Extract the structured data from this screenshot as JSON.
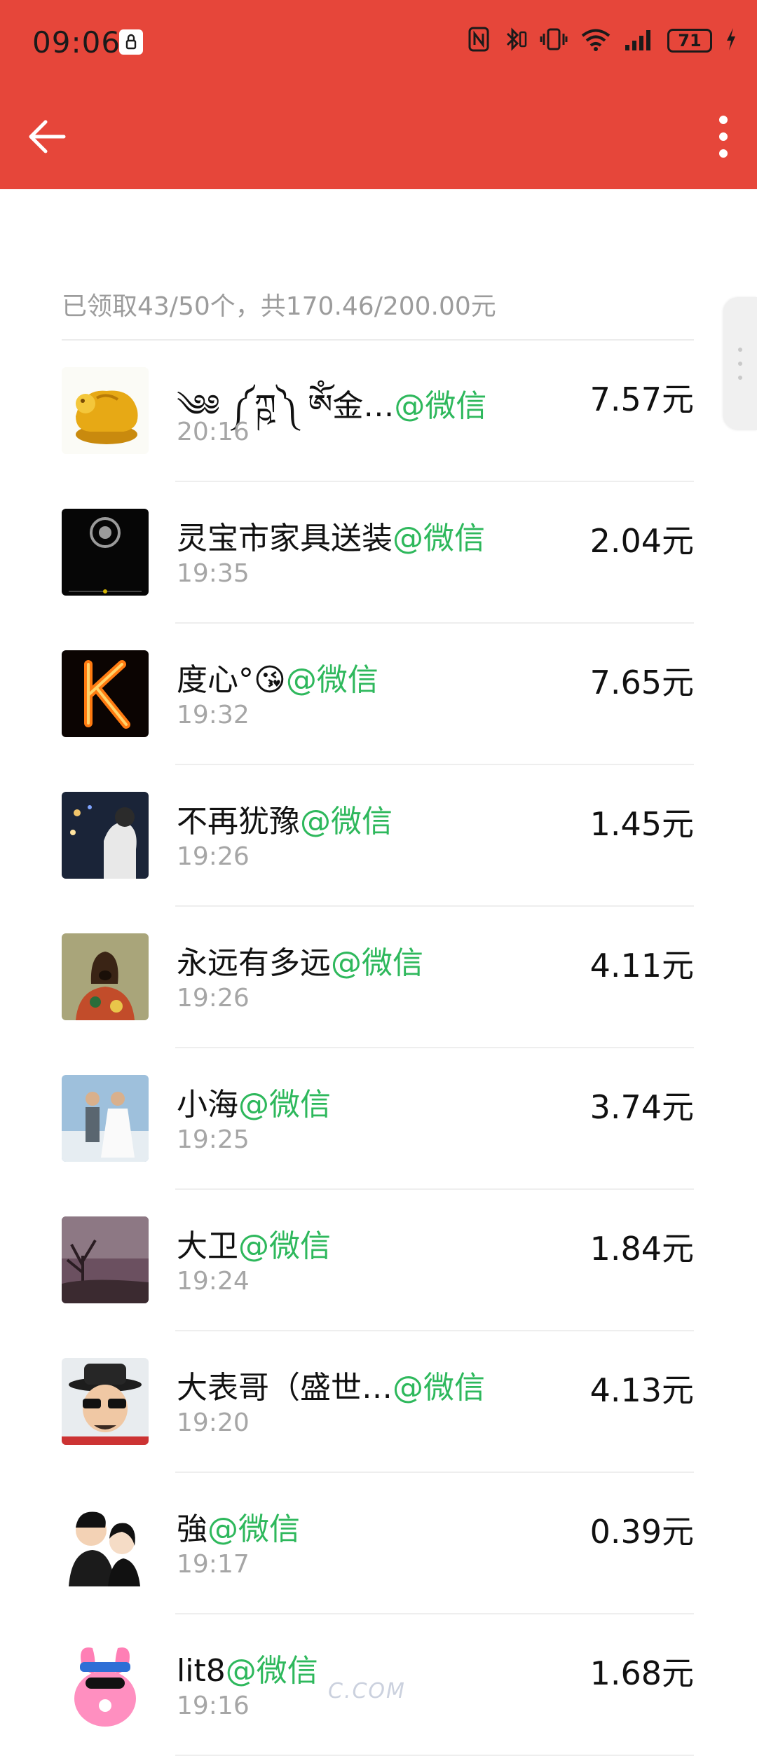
{
  "status_bar": {
    "time": "09:06",
    "battery": "71",
    "notification_icon": "lock-badge-icon",
    "icons": [
      "nfc-icon",
      "bluetooth-icon",
      "vibrate-icon",
      "wifi-icon",
      "signal-icon",
      "battery-icon",
      "charging-icon"
    ]
  },
  "toolbar": {
    "back_icon": "arrow-left-icon",
    "more_icon": "more-vertical-icon",
    "background": "#E6463A"
  },
  "summary": "已领取43/50个，共170.46/200.00元",
  "tag_color": "#2EB85C",
  "records": [
    {
      "name": "༄༅ ༼ཀྵ༽ ཨོཾ金…",
      "tag": "@微信",
      "time": "20:16",
      "amount": "7.57元",
      "avatar_theme": "gold"
    },
    {
      "name": "灵宝市家具送装",
      "tag": "@微信",
      "time": "19:35",
      "amount": "2.04元",
      "avatar_theme": "police"
    },
    {
      "name": "度心°😘",
      "tag": "@微信",
      "time": "19:32",
      "amount": "7.65元",
      "avatar_theme": "fire"
    },
    {
      "name": "不再犹豫",
      "tag": "@微信",
      "time": "19:26",
      "amount": "1.45元",
      "avatar_theme": "night"
    },
    {
      "name": "永远有多远",
      "tag": "@微信",
      "time": "19:26",
      "amount": "4.11元",
      "avatar_theme": "dog"
    },
    {
      "name": "小海",
      "tag": "@微信",
      "time": "19:25",
      "amount": "3.74元",
      "avatar_theme": "wedding"
    },
    {
      "name": "大卫",
      "tag": "@微信",
      "time": "19:24",
      "amount": "1.84元",
      "avatar_theme": "dusk"
    },
    {
      "name": "大表哥（盛世…",
      "tag": "@微信",
      "time": "19:20",
      "amount": "4.13元",
      "avatar_theme": "hat"
    },
    {
      "name": "強",
      "tag": "@微信",
      "time": "19:17",
      "amount": "0.39元",
      "avatar_theme": "cartoon"
    },
    {
      "name": "lit8",
      "tag": "@微信",
      "time": "19:16",
      "amount": "1.68元",
      "avatar_theme": "bunny"
    }
  ],
  "watermark": "C.COM"
}
